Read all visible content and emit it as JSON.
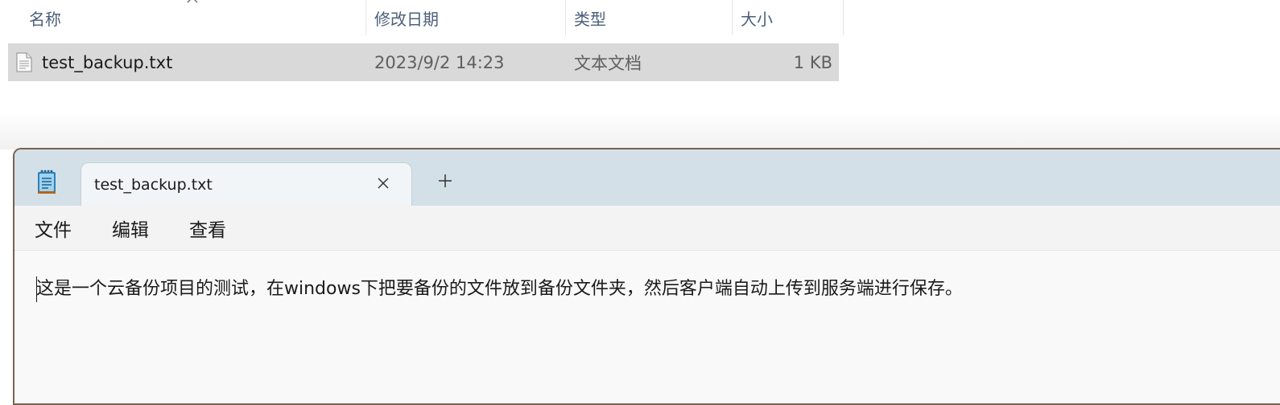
{
  "explorer": {
    "columns": {
      "name": "名称",
      "modified": "修改日期",
      "type": "类型",
      "size": "大小"
    },
    "files": [
      {
        "name": "test_backup.txt",
        "modified": "2023/9/2 14:23",
        "type": "文本文档",
        "size": "1 KB",
        "icon": "text-file-icon",
        "selected": true
      }
    ]
  },
  "notepad": {
    "app_icon": "notepad-icon",
    "tab": {
      "title": "test_backup.txt",
      "close_icon": "close-icon"
    },
    "new_tab_icon": "plus-icon",
    "menu": {
      "file": "文件",
      "edit": "编辑",
      "view": "查看"
    },
    "content": "这是一个云备份项目的测试，在windows下把要备份的文件放到备份文件夹，然后客户端自动上传到服务端进行保存。"
  },
  "colors": {
    "row_selected": "#d9d9d9",
    "titlebar": "#d3e0e8",
    "header_text": "#4c607a",
    "window_border": "#7a6150"
  }
}
